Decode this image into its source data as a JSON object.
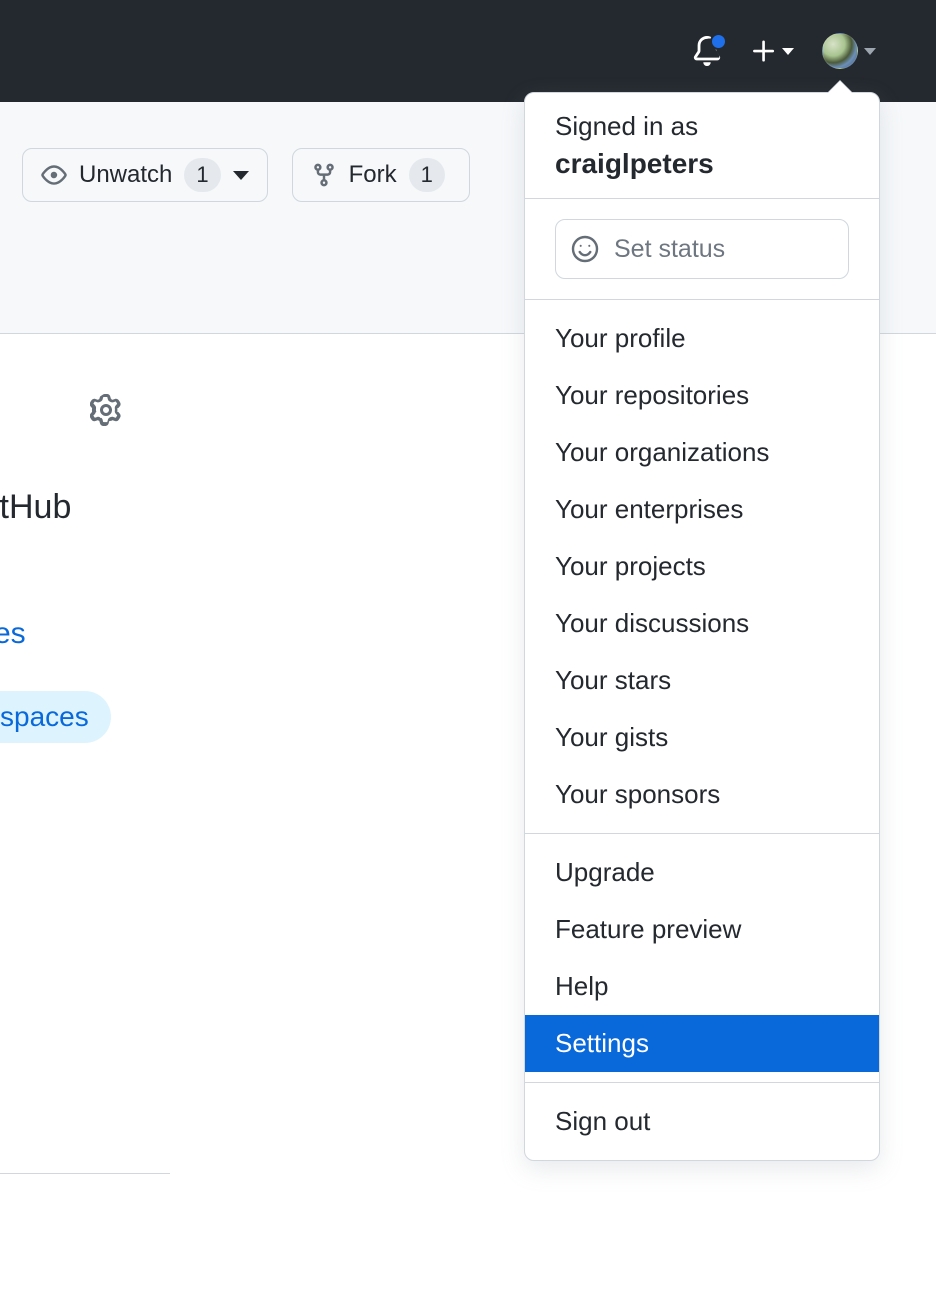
{
  "topbar": {
    "notification_indicator": true
  },
  "repo_actions": {
    "unwatch": {
      "label": "Unwatch",
      "count": "1"
    },
    "fork": {
      "label": "Fork",
      "count": "1"
    }
  },
  "page_fragments": {
    "partial_title": "itHub",
    "link_suffix": "es",
    "pill_label": "spaces"
  },
  "menu": {
    "signed_in_label": "Signed in as",
    "username": "craiglpeters",
    "status_placeholder": "Set status",
    "groups": [
      {
        "items": [
          {
            "id": "profile",
            "label": "Your profile"
          },
          {
            "id": "repositories",
            "label": "Your repositories"
          },
          {
            "id": "organizations",
            "label": "Your organizations"
          },
          {
            "id": "enterprises",
            "label": "Your enterprises"
          },
          {
            "id": "projects",
            "label": "Your projects"
          },
          {
            "id": "discussions",
            "label": "Your discussions"
          },
          {
            "id": "stars",
            "label": "Your stars"
          },
          {
            "id": "gists",
            "label": "Your gists"
          },
          {
            "id": "sponsors",
            "label": "Your sponsors"
          }
        ]
      },
      {
        "items": [
          {
            "id": "upgrade",
            "label": "Upgrade"
          },
          {
            "id": "preview",
            "label": "Feature preview"
          },
          {
            "id": "help",
            "label": "Help"
          },
          {
            "id": "settings",
            "label": "Settings",
            "active": true
          }
        ]
      },
      {
        "items": [
          {
            "id": "signout",
            "label": "Sign out"
          }
        ]
      }
    ]
  }
}
